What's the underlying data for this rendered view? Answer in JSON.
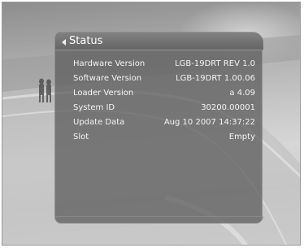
{
  "panel": {
    "title": "Status",
    "rows": [
      {
        "label": "Hardware Version",
        "value": "LGB-19DRT REV 1.0"
      },
      {
        "label": "Software Version",
        "value": "LGB-19DRT 1.00.06"
      },
      {
        "label": "Loader Version",
        "value": "a 4.09"
      },
      {
        "label": "System ID",
        "value": "30200.00001"
      },
      {
        "label": "Update Data",
        "value": "Aug 10 2007 14:37:22"
      },
      {
        "label": "Slot",
        "value": "Empty"
      }
    ]
  },
  "icons": {
    "back": "back-arrow-icon"
  },
  "colors": {
    "panel": "#5f5f5f",
    "text": "#ffffff"
  }
}
